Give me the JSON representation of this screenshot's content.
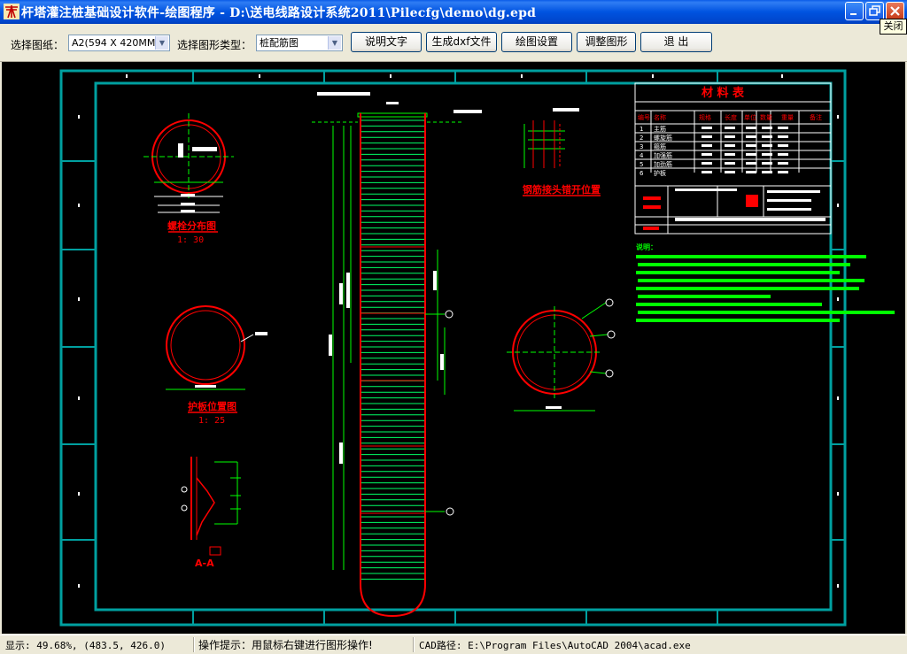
{
  "window": {
    "title": "杆塔灌注桩基础设计软件-绘图程序 - D:\\送电线路设计系统2011\\Pilecfg\\demo\\dg.epd",
    "tooltip": "关闭"
  },
  "toolbar": {
    "paper_label": "选择图纸：",
    "paper_value": "A2(594 X 420MM)",
    "type_label": "选择图形类型：",
    "type_value": "桩配筋图",
    "buttons": [
      "说明文字",
      "生成dxf文件",
      "绘图设置",
      "调整图形",
      "退 出"
    ]
  },
  "drawing": {
    "view1_title": "螺栓分布图",
    "view1_scale": "1: 30",
    "view2_title": "护板位置图",
    "view2_scale": "1: 25",
    "section_label": "A-A",
    "splice_title": "钢筋接头错开位置",
    "table_title": "材  料  表",
    "table_headers": [
      "编号",
      "名称",
      "规格",
      "长度",
      "单位",
      "数量",
      "重量",
      "备注"
    ],
    "table_rows": [
      [
        "1",
        "主筋"
      ],
      [
        "2",
        "螺旋筋"
      ],
      [
        "3",
        "箍筋"
      ],
      [
        "4",
        "加强筋"
      ],
      [
        "5",
        "加劲筋"
      ],
      [
        "6",
        "护板"
      ]
    ],
    "note_label": "说明：",
    "colors": {
      "frame": "#00a0a0",
      "red": "#ff0000",
      "green": "#00ff00",
      "white": "#ffffff",
      "pile_lines": "#00ff66"
    }
  },
  "status": {
    "zoom": "显示: 49.68%, (483.5, 426.0)",
    "hint": "操作提示：用鼠标右键进行图形操作!",
    "cad_path": "CAD路径: E:\\Program Files\\AutoCAD 2004\\acad.exe"
  }
}
